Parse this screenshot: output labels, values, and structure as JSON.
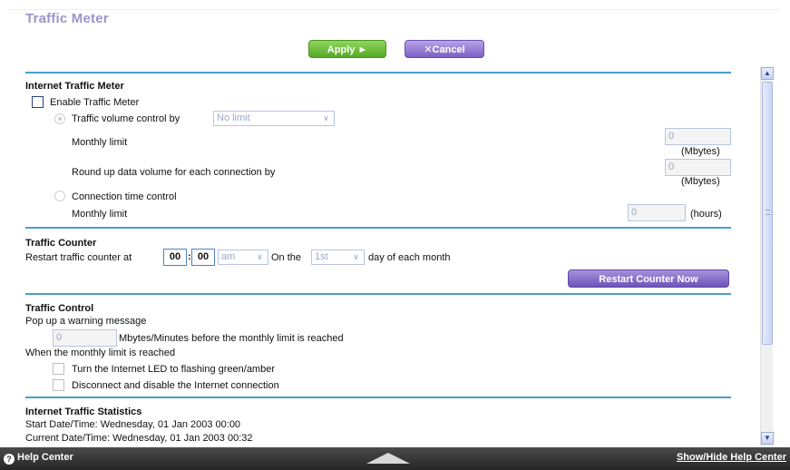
{
  "page_title": "Traffic Meter",
  "buttons": {
    "apply": "Apply ►",
    "cancel": "✕Cancel",
    "restart_counter": "Restart Counter Now"
  },
  "internet_traffic_meter": {
    "heading": "Internet Traffic Meter",
    "enable_label": "Enable Traffic Meter",
    "volume_control_label": "Traffic volume control by",
    "volume_control_value": "No limit",
    "monthly_limit_label": "Monthly limit",
    "monthly_limit_value": "0",
    "mbytes_unit": "(Mbytes)",
    "round_up_label": "Round up data volume for each connection by",
    "round_up_value": "0",
    "connection_time_label": "Connection time control",
    "time_monthly_limit_label": "Monthly limit",
    "time_monthly_limit_value": "0",
    "hours_unit": "(hours)"
  },
  "traffic_counter": {
    "heading": "Traffic Counter",
    "restart_label": "Restart traffic counter at",
    "hour": "00",
    "minute": "00",
    "ampm": "am",
    "on_the_label": "On the",
    "day": "1st",
    "day_suffix": "day of each month"
  },
  "traffic_control": {
    "heading": "Traffic Control",
    "popup_label": "Pop up a warning message",
    "warning_value": "0",
    "warning_suffix": "Mbytes/Minutes before the monthly limit is reached",
    "when_reached_label": "When the monthly limit is reached",
    "led_label": "Turn the Internet LED to flashing green/amber",
    "disconnect_label": "Disconnect and disable the Internet connection"
  },
  "statistics": {
    "heading": "Internet Traffic Statistics",
    "start": "Start Date/Time: Wednesday, 01 Jan 2003 00:00",
    "current": "Current Date/Time: Wednesday, 01 Jan 2003 00:32"
  },
  "help_bar": {
    "left": "Help Center",
    "right": "Show/Hide Help Center"
  }
}
